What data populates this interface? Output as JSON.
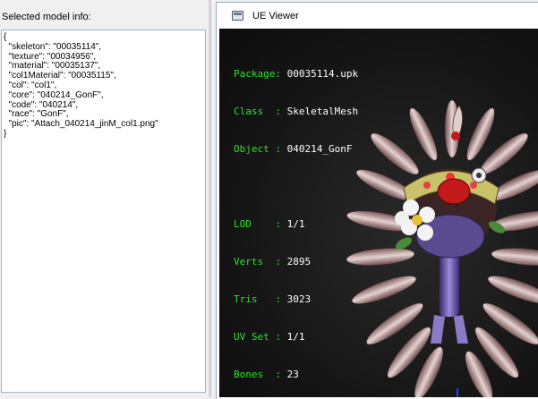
{
  "left_panel": {
    "label": "Selected model info:",
    "json_lines": [
      "{",
      "  \"skeleton\": \"00035114\",",
      "  \"texture\": \"00034956\",",
      "  \"material\": \"00035137\",",
      "  \"col1Material\": \"00035115\",",
      "  \"col\": \"col1\",",
      "  \"core\": \"040214_GonF\",",
      "  \"code\": \"040214\",",
      "  \"race\": \"GonF\",",
      "  \"pic\": \"Attach_040214_jinM_col1.png\"",
      "}"
    ]
  },
  "viewer": {
    "title": "UE Viewer",
    "icon": "window-app-icon",
    "info": {
      "package_key": "Package:",
      "package_val": "00035114.upk",
      "class_key": "Class  :",
      "class_val": "SkeletalMesh",
      "object_key": "Object :",
      "object_val": "040214_GonF",
      "lod_key": "LOD    :",
      "lod_val": "1/1",
      "verts_key": "Verts  :",
      "verts_val": "2895",
      "tris_key": "Tris   :",
      "tris_val": "3023",
      "uvset_key": "UV Set :",
      "uvset_val": "1/1",
      "bones_key": "Bones  :",
      "bones_val": "23"
    },
    "colors": {
      "info_key": "#2fe02f",
      "info_value": "#ffffff",
      "viewport_bg": "#161616"
    }
  }
}
